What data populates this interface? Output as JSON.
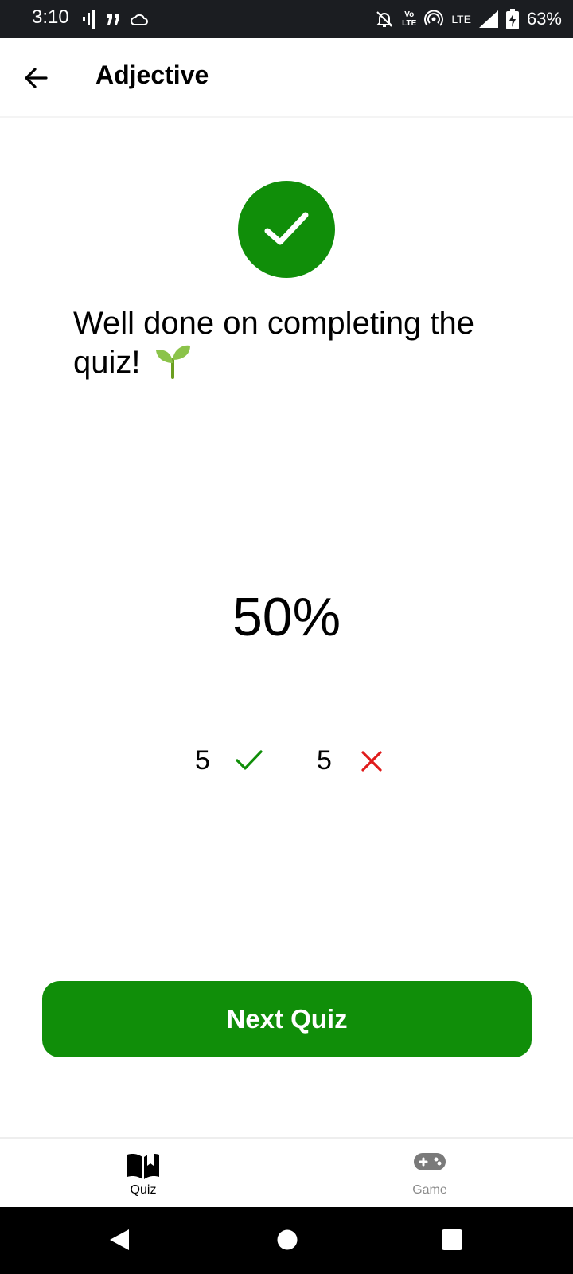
{
  "status_bar": {
    "time": "3:10",
    "volte_top": "Vo",
    "volte_bottom": "LTE",
    "network_label": "LTE",
    "battery_percent": "63%",
    "icons": [
      "signal-bars-icon",
      "quote-icon",
      "cloud-icon",
      "mute-bell-icon",
      "volte-icon",
      "hotspot-icon",
      "cellular-signal-icon",
      "battery-charging-icon"
    ]
  },
  "app_bar": {
    "back_icon": "arrow-left-icon",
    "title": "Adjective"
  },
  "result": {
    "success_icon": "check-circle-icon",
    "message": "Well done on completing the quiz!",
    "emoji_icon": "seedling-icon",
    "score_percent": "50%",
    "correct_count": "5",
    "incorrect_count": "5",
    "correct_icon": "check-icon",
    "incorrect_icon": "cross-icon",
    "colors": {
      "success": "#108e09",
      "error": "#e01b1b"
    }
  },
  "actions": {
    "next_label": "Next Quiz"
  },
  "bottom_nav": {
    "items": [
      {
        "label": "Quiz",
        "icon": "open-book-icon",
        "active": true
      },
      {
        "label": "Game",
        "icon": "gamepad-icon",
        "active": false
      }
    ]
  },
  "system_nav": {
    "icons": [
      "back-triangle-icon",
      "home-circle-icon",
      "recents-square-icon"
    ]
  }
}
